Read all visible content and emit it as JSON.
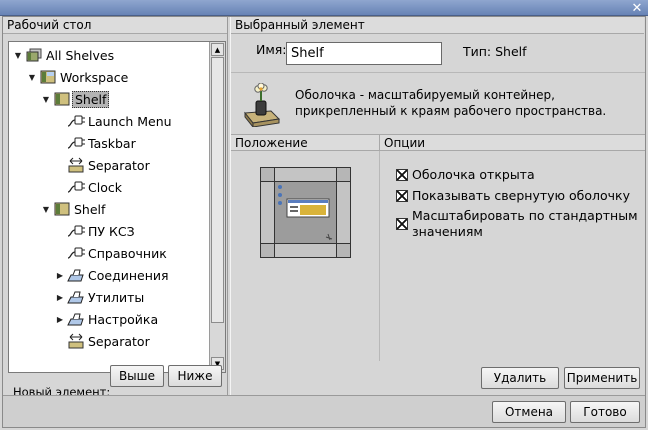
{
  "window": {
    "close_glyph": "✕"
  },
  "left": {
    "header": "Рабочий стол",
    "tree": [
      {
        "label": "All Shelves",
        "icon": "all-shelves-icon",
        "arrow": "down"
      },
      {
        "label": "Workspace",
        "icon": "workspace-icon",
        "arrow": "down"
      },
      {
        "label": "Shelf",
        "icon": "shelf-icon",
        "arrow": "down",
        "selected": true
      },
      {
        "label": "Launch Menu",
        "icon": "plug-icon"
      },
      {
        "label": "Taskbar",
        "icon": "plug-icon"
      },
      {
        "label": "Separator",
        "icon": "separator-icon"
      },
      {
        "label": "Clock",
        "icon": "plug-icon"
      },
      {
        "label": "Shelf",
        "icon": "shelf-icon",
        "arrow": "down"
      },
      {
        "label": "ПУ КСЗ",
        "icon": "plug-icon"
      },
      {
        "label": "Справочник",
        "icon": "plug-icon"
      },
      {
        "label": "Соединения",
        "icon": "drawer-icon",
        "arrow": "right"
      },
      {
        "label": "Утилиты",
        "icon": "drawer-icon",
        "arrow": "right"
      },
      {
        "label": "Настройка",
        "icon": "drawer-icon",
        "arrow": "right"
      },
      {
        "label": "Separator",
        "icon": "separator-icon"
      }
    ],
    "new_label": "Новый элемент:",
    "above_button": "Выше",
    "below_button": "Ниже"
  },
  "right": {
    "header": "Выбранный элемент",
    "name_label": "Имя:",
    "name_value": "Shelf",
    "type_label": "Тип: Shelf",
    "desc_line1": "Оболочка - масштабируемый контейнер,",
    "desc_line2": "прикрепленный к краям рабочего пространства.",
    "position_header": "Положение",
    "options_header": "Опции",
    "options": [
      {
        "label": "Оболочка открыта",
        "checked": true
      },
      {
        "label": "Показывать свернутую оболочку",
        "checked": true
      },
      {
        "label": "Масштабировать по стандартным",
        "label2": "значениям",
        "checked": true
      }
    ],
    "delete_button": "Удалить",
    "apply_button": "Применить"
  },
  "footer": {
    "cancel_button": "Отмена",
    "ok_button": "Готово"
  }
}
